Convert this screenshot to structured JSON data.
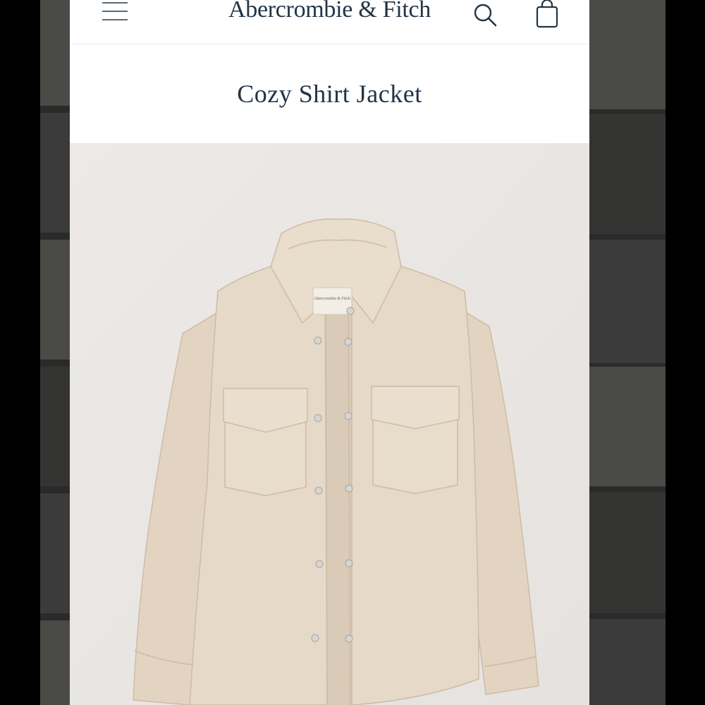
{
  "header": {
    "brand": "Abercrombie & Fitch",
    "menu_icon": "hamburger-menu-icon",
    "search_icon": "search-icon",
    "bag_icon": "shopping-bag-icon"
  },
  "product": {
    "title": "Cozy Shirt Jacket",
    "image_tag_text": "Abercrombie & Fitch"
  },
  "colors": {
    "brand_text": "#223445",
    "jacket": "#e4d7c5",
    "image_background": "#eae7e4"
  }
}
